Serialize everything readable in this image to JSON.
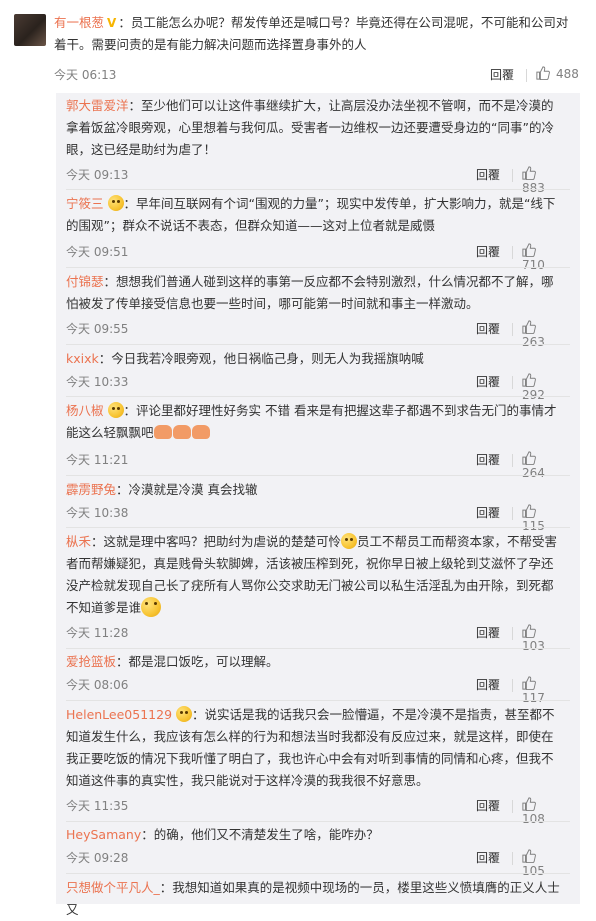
{
  "main_comment": {
    "username": "有一根葱",
    "badge": "V",
    "separator": "：",
    "text": "员工能怎么办呢？帮发传单还是喊口号？毕竟还得在公司混呢，不可能和公司对着干。需要问责的是有能力解决问题而选择置身事外的人",
    "time": "今天 06:13",
    "reply_label": "回覆",
    "likes": "488"
  },
  "replies": [
    {
      "username": "郭大雷爱洋",
      "text": "：至少他们可以让这件事继续扩大，让高层没办法坐视不管啊，而不是冷漠的拿着饭盆冷眼旁观，心里想着与我何瓜。受害者一边维权一边还要遭受身边的“同事”的冷眼，这已经是助纣为虐了！",
      "time": "今天 09:13",
      "reply_label": "回覆",
      "likes": "883"
    },
    {
      "username": "宁筱三",
      "text": "：早年间互联网有个词“围观的力量”；现实中发传单，扩大影响力，就是“线下的围观”；群众不说话不表态，但群众知道——这对上位者就是威慑",
      "time": "今天 09:51",
      "reply_label": "回覆",
      "likes": "710"
    },
    {
      "username": "付锦瑟",
      "text": "：想想我们普通人碰到这样的事第一反应都不会特别激烈，什么情况都不了解，哪怕被发了传单接受信息也要一些时间，哪可能第一时间就和事主一样激动。",
      "time": "今天 09:55",
      "reply_label": "回覆",
      "likes": "263"
    },
    {
      "username": "kxixk",
      "text": "：今日我若冷眼旁观，他日祸临己身，则无人为我摇旗呐喊",
      "time": "今天 10:33",
      "reply_label": "回覆",
      "likes": "292"
    },
    {
      "username": "杨八椒",
      "text": "：评论里都好理性好务实 不错 看来是有把握这辈子都遇不到求告无门的事情才能这么轻飘飘吧",
      "time": "今天 11:21",
      "reply_label": "回覆",
      "likes": "264"
    },
    {
      "username": "霹雳野兔",
      "text": "：冷漠就是冷漠 真会找辙",
      "time": "今天 10:38",
      "reply_label": "回覆",
      "likes": "115"
    },
    {
      "username": "枞禾",
      "text_a": "：这就是理中客吗？把助纣为虐说的楚楚可怜",
      "text_b": "员工不帮员工而帮资本家，不帮受害者而帮嫌疑犯，真是贱骨头软脚婢，活该被压榨到死，祝你早日被上级轮到艾滋怀了孕还没产检就发现自己长了疣所有人骂你公交求助无门被公司以私生活淫乱为由开除，到死都不知道爹是谁",
      "time": "今天 11:28",
      "reply_label": "回覆",
      "likes": "103"
    },
    {
      "username": "爱抢篮板",
      "text": "：都是混口饭吃，可以理解。",
      "time": "今天 08:06",
      "reply_label": "回覆",
      "likes": "117"
    },
    {
      "username": "HelenLee051129",
      "text": "：说实话是我的话我只会一脸懵逼，不是冷漠不是指责，甚至都不知道发生什么，我应该有怎么样的行为和想法当时我都没有反应过来，就是这样，即使在我正要吃饭的情况下我听懂了明白了，我也许心中会有对听到事情的同情和心疼，但我不知道这件事的真实性，我只能说对于这样冷漠的我我很不好意思。",
      "time": "今天 11:35",
      "reply_label": "回覆",
      "likes": "108"
    },
    {
      "username": "HeySamany",
      "text": "：的确，他们又不清楚发生了啥，能咋办？",
      "time": "今天 09:28",
      "reply_label": "回覆",
      "likes": "105"
    },
    {
      "username": "只想做个平凡人_",
      "text": "：我想知道如果真的是视频中现场的一员，楼里这些义愤填膺的正义人士又"
    }
  ],
  "colors": {
    "username": "#eb7350",
    "background_sub": "#f2f2f5",
    "vip_badge": "#f7b500",
    "meta": "#808080"
  }
}
